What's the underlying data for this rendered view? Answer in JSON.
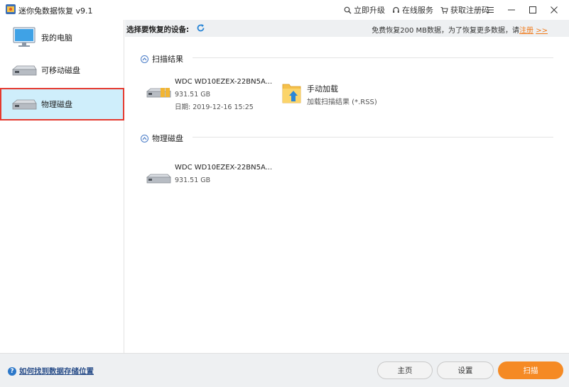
{
  "window": {
    "title": "迷你兔数据恢复 v9.1",
    "actions": {
      "upgrade": "立即升级",
      "online_service": "在线服务",
      "get_code": "获取注册码"
    }
  },
  "sidebar": {
    "items": [
      {
        "label": "我的电脑",
        "icon": "monitor-icon"
      },
      {
        "label": "可移动磁盘",
        "icon": "drive-icon"
      },
      {
        "label": "物理磁盘",
        "icon": "drive-icon",
        "active": true
      }
    ]
  },
  "main": {
    "select_label": "选择要恢复的设备:",
    "promo_text": "免费恢复200 MB数据，为了恢复更多数据，请",
    "promo_link": "注册",
    "promo_arrow": ">>",
    "sections": [
      {
        "title": "扫描结果",
        "device": {
          "name": "WDC WD10EZEX-22BN5A...",
          "size": "931.51 GB",
          "date": "日期: 2019-12-16 15:25"
        },
        "manual": {
          "title": "手动加载",
          "subtitle": "加载扫描结果 (*.RSS)"
        }
      },
      {
        "title": "物理磁盘",
        "device": {
          "name": "WDC WD10EZEX-22BN5A...",
          "size": "931.51 GB"
        }
      }
    ]
  },
  "footer": {
    "help_text": "如何找到数据存储位置",
    "home_label": "主页",
    "settings_label": "设置",
    "scan_label": "扫描"
  },
  "colors": {
    "accent_orange": "#f58a24",
    "active_bg": "#cfeefb",
    "active_border": "#e53a2f",
    "link_blue": "#2b4f8a"
  }
}
